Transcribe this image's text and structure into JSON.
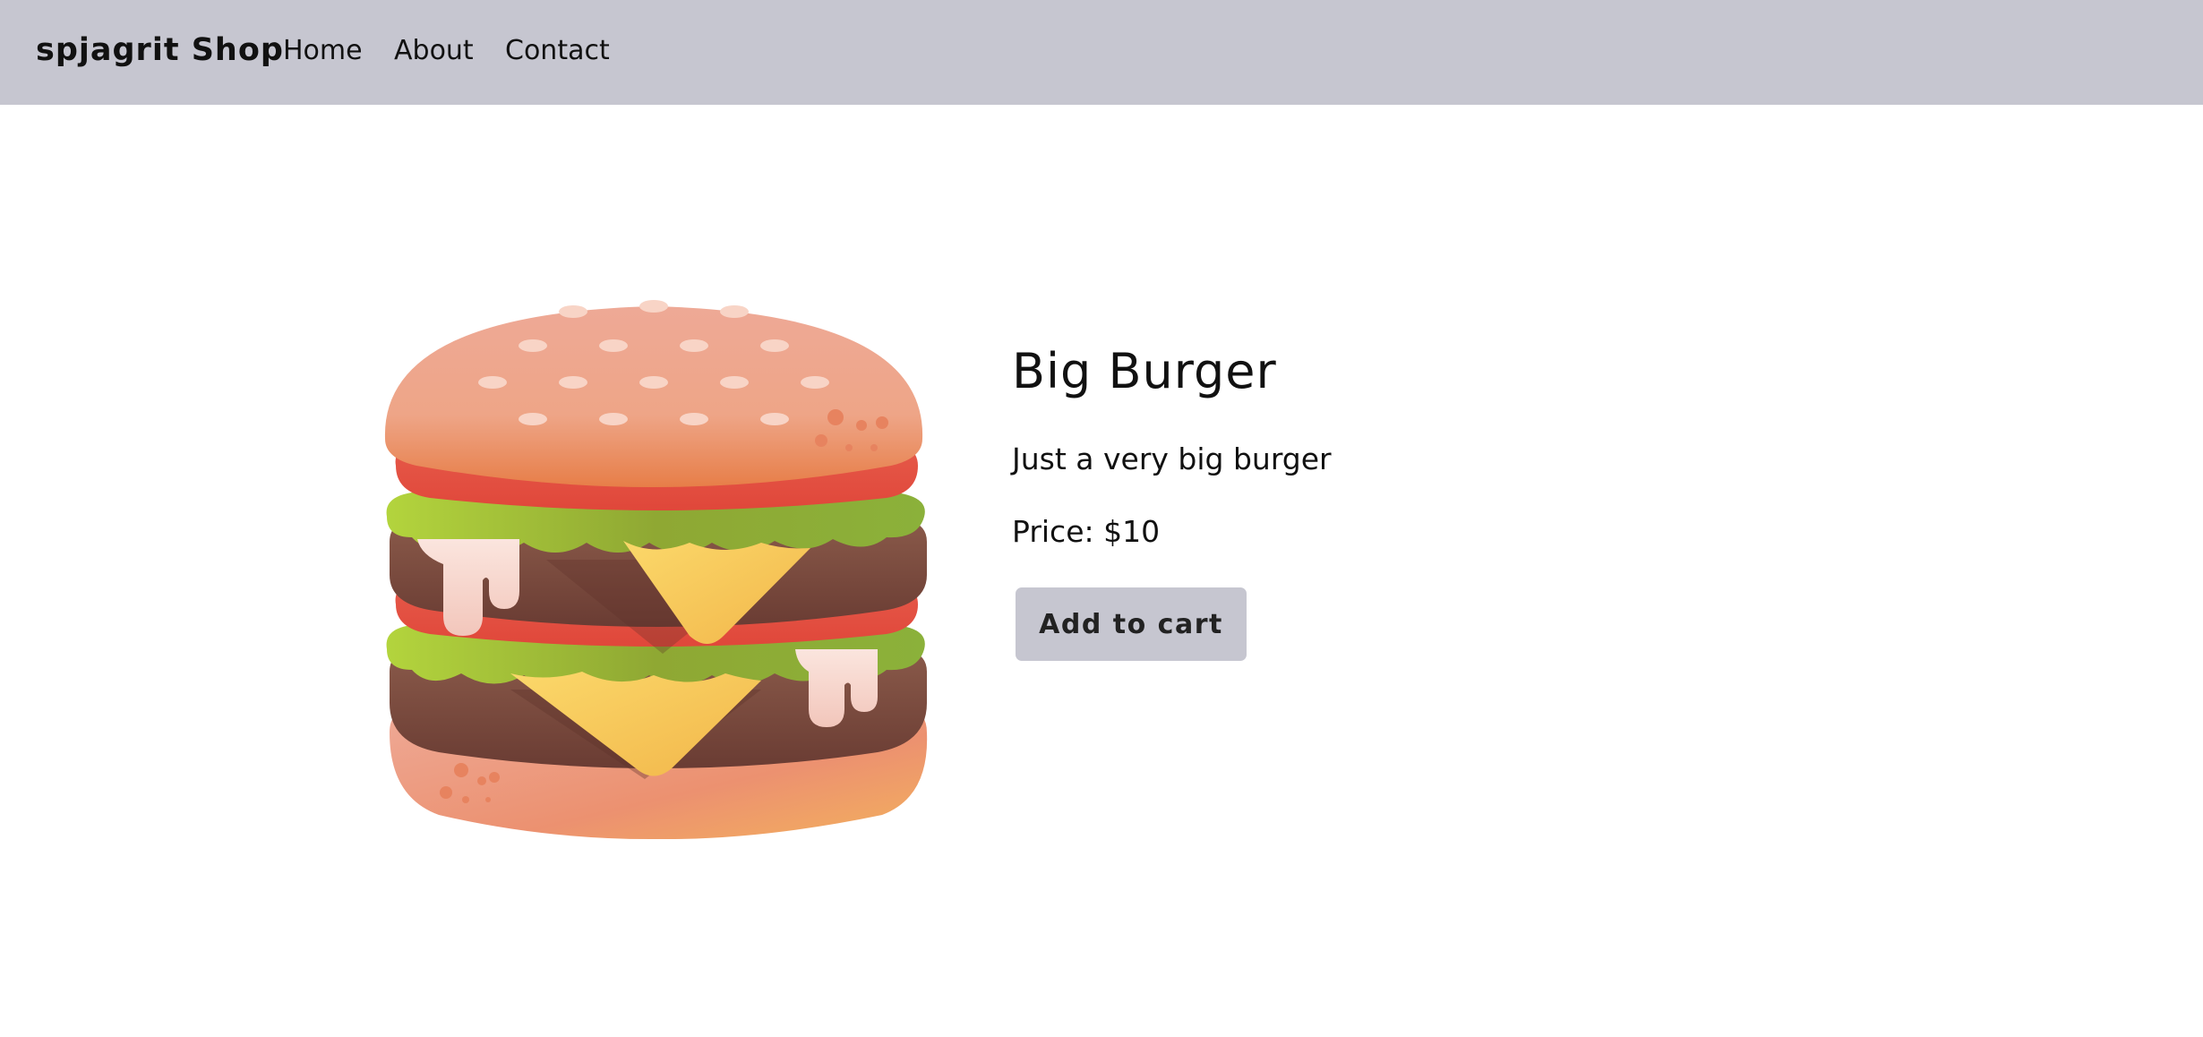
{
  "navbar": {
    "brand": "spjagrit Shop",
    "links": [
      {
        "label": "Home"
      },
      {
        "label": "About"
      },
      {
        "label": "Contact"
      }
    ],
    "background": "#c6c6d0"
  },
  "product": {
    "image_icon": "burger-image",
    "title": "Big Burger",
    "description": "Just a very big burger",
    "price": "Price: $10",
    "add_to_cart_label": "Add to cart"
  },
  "colors": {
    "accent": "#c6c6d0",
    "text": "#111111",
    "background": "#ffffff"
  }
}
